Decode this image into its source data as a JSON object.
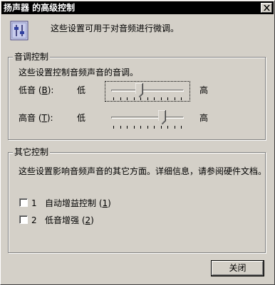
{
  "window": {
    "title": "扬声器 的高级控制"
  },
  "titlebar": {
    "close_glyph": "×"
  },
  "header": {
    "description": "这些设置可用于对音频进行微调。",
    "icon": "speaker-settings-icon"
  },
  "tone": {
    "group_label": "音调控制",
    "description": "这些设置控制音频声音的音调。",
    "bass": {
      "label": "低音",
      "accel_open": " (",
      "accel": "B",
      "accel_close": "):",
      "low": "低",
      "high": "高",
      "value": 0.37
    },
    "treble": {
      "label": "高音",
      "accel_open": " (",
      "accel": "T",
      "accel_close": "):",
      "low": "低",
      "high": "高",
      "value": 0.73
    }
  },
  "other": {
    "group_label": "其它控制",
    "description": "这些设置影响音频声音的其它方面。详细信息，请参阅硬件文档。",
    "options": [
      {
        "num": "1",
        "label": "自动增益控制",
        "accel_open": " (",
        "accel": "1",
        "accel_close": ")",
        "checked": false
      },
      {
        "num": "2",
        "label": "低音增强",
        "accel_open": " (",
        "accel": "2",
        "accel_close": ")",
        "checked": false
      }
    ]
  },
  "footer": {
    "close_button": "关闭"
  }
}
